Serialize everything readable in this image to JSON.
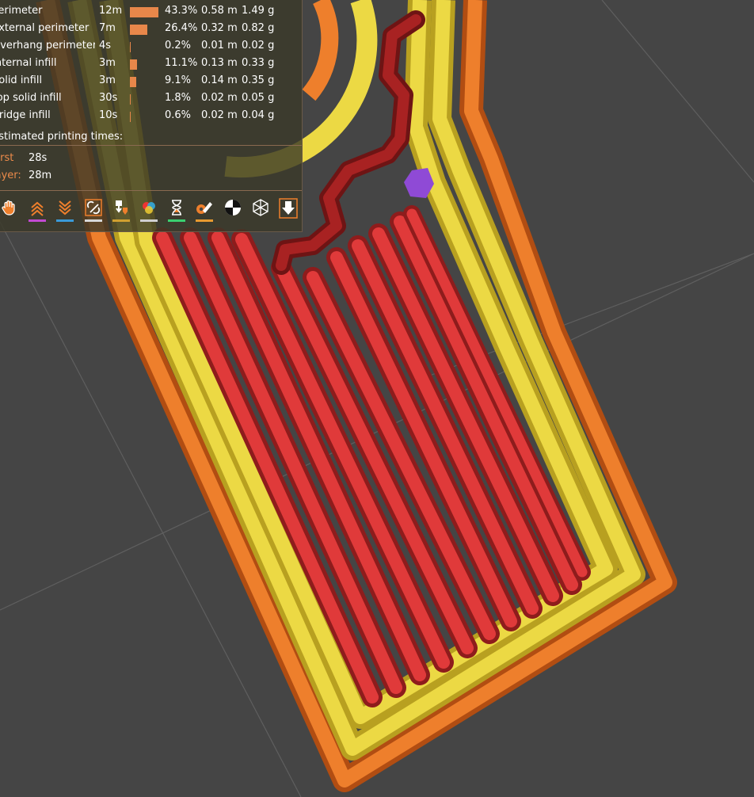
{
  "legend": {
    "rows": [
      {
        "name": "Perimeter",
        "time": "12m",
        "bar_fraction": 0.433,
        "percent": "43.3%",
        "length": "0.58 m",
        "weight": "1.49 g"
      },
      {
        "name": "External perimeter",
        "time": "7m",
        "bar_fraction": 0.264,
        "percent": "26.4%",
        "length": "0.32 m",
        "weight": "0.82 g"
      },
      {
        "name": "Overhang perimeter",
        "time": "4s",
        "bar_fraction": 0.002,
        "percent": "0.2%",
        "length": "0.01 m",
        "weight": "0.02 g"
      },
      {
        "name": "Internal infill",
        "time": "3m",
        "bar_fraction": 0.111,
        "percent": "11.1%",
        "length": "0.13 m",
        "weight": "0.33 g"
      },
      {
        "name": "Solid infill",
        "time": "3m",
        "bar_fraction": 0.091,
        "percent": "9.1%",
        "length": "0.14 m",
        "weight": "0.35 g"
      },
      {
        "name": "Top solid infill",
        "time": "30s",
        "bar_fraction": 0.018,
        "percent": "1.8%",
        "length": "0.02 m",
        "weight": "0.05 g"
      },
      {
        "name": "Bridge infill",
        "time": "10s",
        "bar_fraction": 0.006,
        "percent": "0.6%",
        "length": "0.02 m",
        "weight": "0.04 g"
      }
    ],
    "estimated_title": "Estimated printing times:",
    "first_layer_label": "First layer:",
    "first_layer_value": "28s",
    "total_value": "28m"
  },
  "toolbar": {
    "buttons": [
      {
        "icon": "travel-hand-icon",
        "underline": ""
      },
      {
        "icon": "wipe-up-icon",
        "underline": "#c34ad2"
      },
      {
        "icon": "retraction-down-icon",
        "underline": "#3a9ad8"
      },
      {
        "icon": "seams-icon",
        "underline": "#d8d8d8",
        "active": true
      },
      {
        "icon": "tool-change-icon",
        "underline": "#d0a030"
      },
      {
        "icon": "color-change-icon",
        "underline": "#d0d0d0"
      },
      {
        "icon": "pause-print-icon",
        "underline": "#3ad070"
      },
      {
        "icon": "custom-gcode-icon",
        "underline": "#e89a30"
      },
      {
        "icon": "center-of-gravity-icon",
        "underline": ""
      },
      {
        "icon": "shells-icon",
        "underline": ""
      },
      {
        "icon": "tool-marker-icon",
        "underline": "",
        "active": true
      }
    ]
  },
  "colors": {
    "background": "#454545",
    "perimeter": "#e6cf3a",
    "external_perimeter": "#e97826",
    "solid_infill": "#d93636",
    "internal_infill": "#a82020",
    "seam": "#8f4ad6",
    "bar": "#e8874a"
  }
}
